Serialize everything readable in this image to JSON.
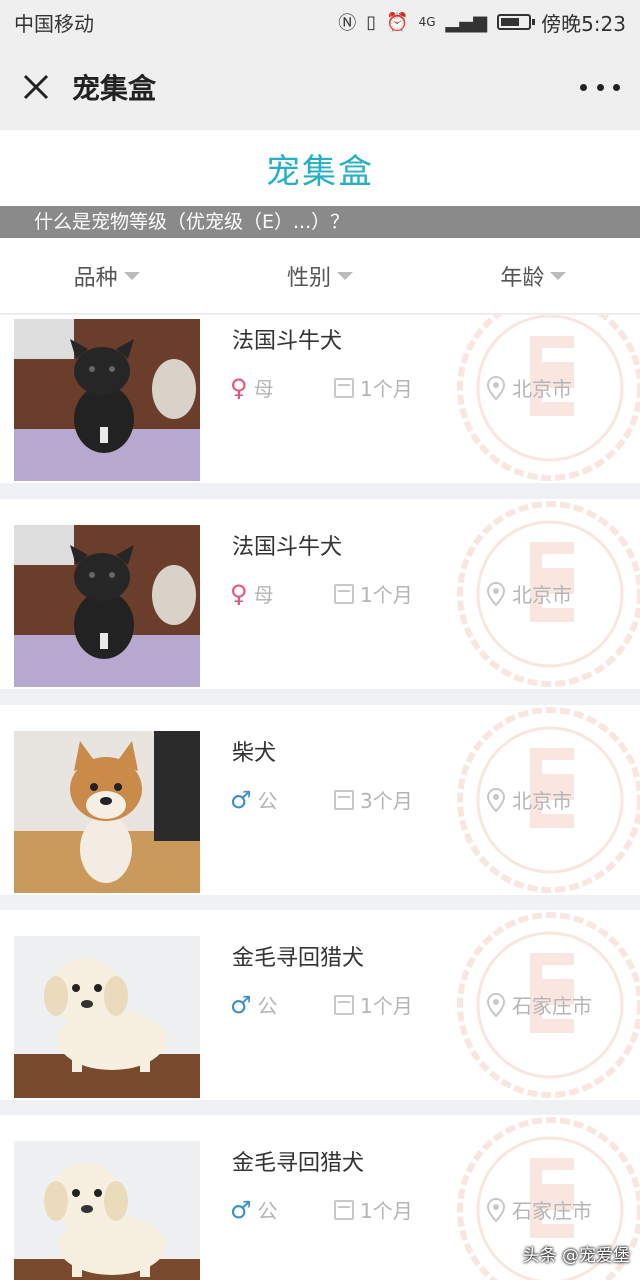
{
  "status_bar": {
    "carrier": "中国移动",
    "network": "4G",
    "time": "傍晚5:23",
    "battery_level": 0.7
  },
  "nav": {
    "title": "宠集盒"
  },
  "header": {
    "brand": "宠集盒"
  },
  "notice": {
    "text": "什么是宠物等级（优宠级（E）...）？"
  },
  "filters": [
    {
      "label": "品种"
    },
    {
      "label": "性别"
    },
    {
      "label": "年龄"
    }
  ],
  "pets": [
    {
      "name": "法国斗牛犬",
      "gender": "母",
      "gender_symbol": "♀",
      "gender_color": "#e8527a",
      "age": "1个月",
      "city": "北京市",
      "photo": "french-bulldog"
    },
    {
      "name": "法国斗牛犬",
      "gender": "母",
      "gender_symbol": "♀",
      "gender_color": "#e8527a",
      "age": "1个月",
      "city": "北京市",
      "photo": "french-bulldog"
    },
    {
      "name": "柴犬",
      "gender": "公",
      "gender_symbol": "♂",
      "gender_color": "#3a8fd0",
      "age": "3个月",
      "city": "北京市",
      "photo": "shiba-inu"
    },
    {
      "name": "金毛寻回猎犬",
      "gender": "公",
      "gender_symbol": "♂",
      "gender_color": "#3a8fd0",
      "age": "1个月",
      "city": "石家庄市",
      "photo": "golden-retriever"
    },
    {
      "name": "金毛寻回猎犬",
      "gender": "公",
      "gender_symbol": "♂",
      "gender_color": "#3a8fd0",
      "age": "1个月",
      "city": "石家庄市",
      "photo": "golden-retriever"
    }
  ],
  "watermark": "头条 @宠爱堡",
  "colors": {
    "brand": "#27b0c5",
    "female": "#e8527a",
    "male": "#3a8fd0",
    "seal": "#f2b8a8"
  }
}
